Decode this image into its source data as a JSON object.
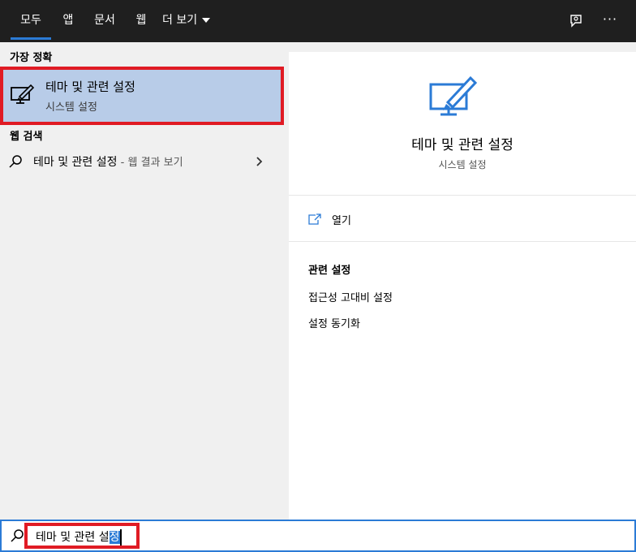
{
  "tabs": [
    {
      "label": "모두",
      "active": true
    },
    {
      "label": "앱"
    },
    {
      "label": "문서"
    },
    {
      "label": "웹"
    },
    {
      "label": "더 보기"
    }
  ],
  "top_icons": [
    "feedback-icon",
    "more-options-icon"
  ],
  "best_match": {
    "section_label": "가장 정확",
    "title": "테마 및 관련 설정",
    "subtitle": "시스템 설정",
    "icon": "personalization-icon"
  },
  "web_search": {
    "section_label": "웹 검색",
    "query": "테마 및 관련 설정",
    "suffix": " - 웹 결과 보기",
    "icon": "search-icon"
  },
  "detail": {
    "title": "테마 및 관련 설정",
    "subtitle": "시스템 설정",
    "open_label": "열기",
    "related_heading": "관련 설정",
    "related_links": [
      "접근성 고대비 설정",
      "설정 동기화"
    ]
  },
  "search_box": {
    "text_plain": "테마 및 관련 설",
    "text_selected": "정"
  },
  "colors": {
    "accent": "#2b7bd6",
    "highlight": "#e01b24",
    "topbar": "#1f1f1f",
    "selected_bg": "#b8cce8"
  }
}
